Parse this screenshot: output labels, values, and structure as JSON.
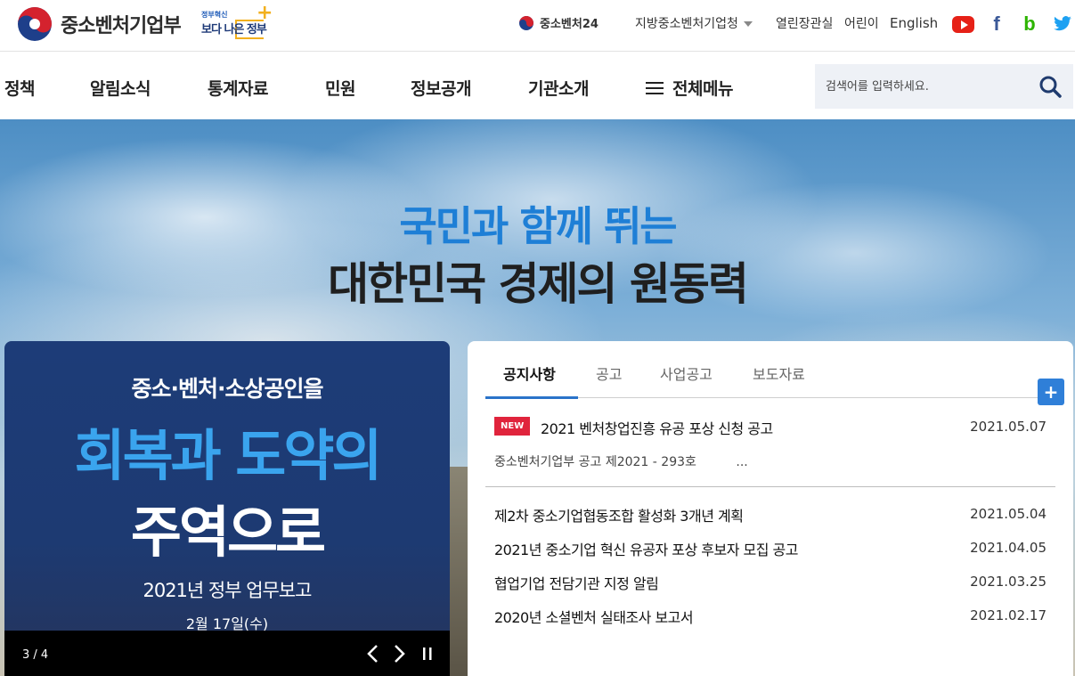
{
  "header": {
    "logo_text": "중소벤처기업부",
    "slogan_small": "정부혁신",
    "slogan_big": "보다 나은 정부",
    "utility": {
      "venture24": "중소벤처24",
      "regional": "지방중소벤처기업청",
      "open_hall": "열린장관실",
      "kids": "어린이",
      "english": "English"
    },
    "sns": [
      "youtube-icon",
      "facebook-icon",
      "blog-icon",
      "twitter-icon"
    ]
  },
  "nav": {
    "items": [
      "정책",
      "알림소식",
      "통계자료",
      "민원",
      "정보공개",
      "기관소개"
    ],
    "all_menu": "전체메뉴",
    "search_placeholder": "검색어를 입력하세요."
  },
  "hero": {
    "line1": "국민과 함께 뛰는",
    "line2": "대한민국 경제의 원동력"
  },
  "banner": {
    "top": "중소·벤처·소상공인을",
    "big1": "회복과 도약의",
    "big2": "주역으로",
    "sub": "2021년 정부 업무보고",
    "date": "2월 17일(수)",
    "counter": "3 / 4"
  },
  "notices": {
    "tabs": [
      "공지사항",
      "공고",
      "사업공고",
      "보도자료"
    ],
    "more_label": "+",
    "featured": {
      "badge": "NEW",
      "title": "2021 벤처창업진흥 유공 포상 신청 공고",
      "date": "2021.05.07",
      "desc": "중소벤처기업부 공고 제2021 - 293호          ..."
    },
    "list": [
      {
        "title": "제2차 중소기업협동조합 활성화 3개년 계획",
        "date": "2021.05.04"
      },
      {
        "title": "2021년 중소기업 혁신 유공자 포상 후보자 모집 공고",
        "date": "2021.04.05"
      },
      {
        "title": "협업기업 전담기관 지정 알림",
        "date": "2021.03.25"
      },
      {
        "title": "2020년 소셜벤처 실태조사 보고서",
        "date": "2021.02.17"
      }
    ]
  },
  "colors": {
    "accent_blue": "#2a73c9",
    "hero_blue": "#1e7fd6",
    "new_red": "#e0243c"
  }
}
